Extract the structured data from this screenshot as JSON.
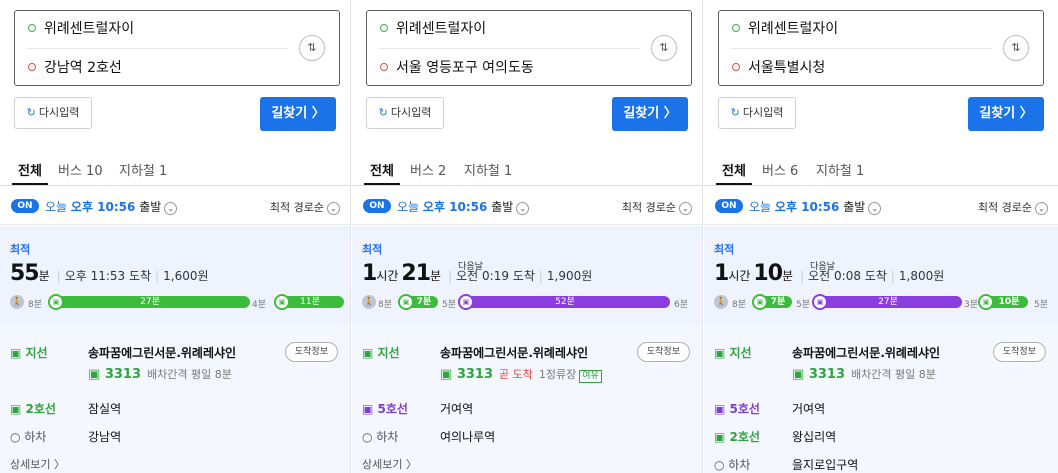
{
  "common": {
    "origin": "위례센트럴자이",
    "reset_label": "다시입력",
    "search_label": "길찾기 〉",
    "tab_all": "전체",
    "on": "ON",
    "today": "오늘",
    "depart_time": "오후 10:56",
    "depart_suffix": "출발",
    "sort_label": "최적 경로순",
    "best": "최적",
    "arrival_info": "도착정보",
    "detail": "상세보기 〉",
    "next_day": "다음날",
    "minute": "분",
    "hour": "시간",
    "dropoff": "하차"
  },
  "panels": [
    {
      "destination": "강남역 2호선",
      "tab_bus": "버스 10",
      "tab_subway": "지하철 1",
      "big_minutes": "55",
      "arrive": "오후 11:53 도착",
      "fare": "1,600원",
      "timeline": {
        "walk1": "8분",
        "seg1": "27분",
        "walk2": "4분",
        "seg2": "11분"
      },
      "steps": [
        {
          "type": "지선",
          "name": "송파꿈에그린서문.위례레샤인",
          "bus_no": "3313",
          "interval": "배차간격 평일 8분"
        },
        {
          "type": "2호선",
          "name": "잠실역"
        },
        {
          "type": "하차",
          "name": "강남역"
        }
      ]
    },
    {
      "destination": "서울 영등포구 여의도동",
      "tab_bus": "버스 2",
      "tab_subway": "지하철 1",
      "big_hours": "1",
      "big_minutes": "21",
      "arrive": "오전 0:19 도착",
      "fare": "1,900원",
      "timeline": {
        "walk1": "8분",
        "pill": "7분",
        "walk2": "5분",
        "seg1": "52분",
        "walk3": "6분"
      },
      "steps": [
        {
          "type": "지선",
          "name": "송파꿈에그린서문.위례레샤인",
          "bus_no": "3313",
          "soon": "곧 도착",
          "stops": "1정류장",
          "roomy": "여유"
        },
        {
          "type": "5호선",
          "name": "거여역"
        },
        {
          "type": "하차",
          "name": "여의나루역"
        }
      ]
    },
    {
      "destination": "서울특별시청",
      "tab_bus": "버스 6",
      "tab_subway": "지하철 1",
      "big_hours": "1",
      "big_minutes": "10",
      "arrive": "오전 0:08 도착",
      "fare": "1,800원",
      "timeline": {
        "walk1": "8분",
        "pill": "7분",
        "walk2": "5분",
        "seg1": "27분",
        "walk3": "3분",
        "pill2": "10분",
        "walk4": "5분"
      },
      "steps": [
        {
          "type": "지선",
          "name": "송파꿈에그린서문.위례레샤인",
          "bus_no": "3313",
          "interval": "배차간격 평일 8분"
        },
        {
          "type": "5호선",
          "name": "거여역"
        },
        {
          "type": "2호선",
          "name": "왕십리역"
        },
        {
          "type": "하차",
          "name": "을지로입구역"
        }
      ]
    }
  ],
  "colors": {
    "accent": "#1a73e8",
    "bus_green": "#3dbb3d",
    "line5_purple": "#8b3ee0",
    "line2_green": "#3dbb3d"
  },
  "icons": {
    "swap": "swap-vertical-icon",
    "reset": "refresh-icon",
    "walk": "walk-icon",
    "bus": "bus-icon",
    "subway": "subway-icon"
  }
}
